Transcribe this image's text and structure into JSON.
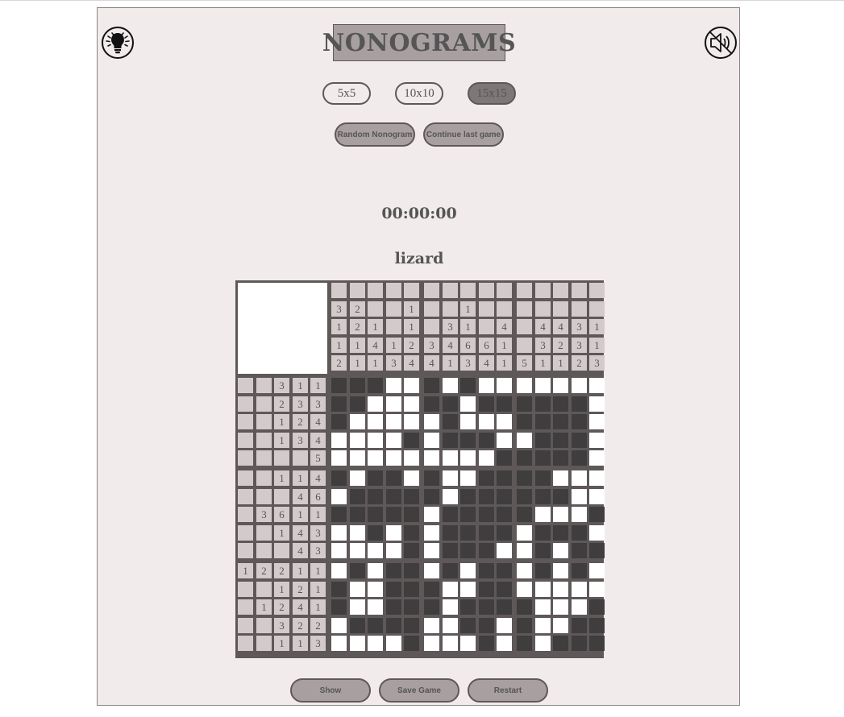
{
  "app": {
    "title": "NONOGRAMS",
    "hint_icon": "lightbulb-icon",
    "sound_icon": "speaker-muted-icon"
  },
  "sizes": [
    {
      "label": "5x5",
      "active": false
    },
    {
      "label": "10x10",
      "active": false
    },
    {
      "label": "15x15",
      "active": true
    }
  ],
  "actions": {
    "random": "Random Nonogram",
    "continue": "Continue last game"
  },
  "timer": "00:00:00",
  "puzzle_name": "lizard",
  "board": {
    "size": 15,
    "col_clues": [
      [
        "3",
        "1",
        "1",
        "2"
      ],
      [
        "2",
        "2",
        "1",
        "1"
      ],
      [
        "1",
        "4",
        "1"
      ],
      [
        "1",
        "3"
      ],
      [
        "1",
        "1",
        "2",
        "4"
      ],
      [
        "3",
        "4"
      ],
      [
        "3",
        "4",
        "1"
      ],
      [
        "1",
        "1",
        "6",
        "3"
      ],
      [
        "6",
        "4"
      ],
      [
        "4",
        "1",
        "1"
      ],
      [
        "5"
      ],
      [
        "4",
        "3",
        "1"
      ],
      [
        "4",
        "2",
        "1"
      ],
      [
        "3",
        "3",
        "2"
      ],
      [
        "1",
        "1",
        "3"
      ]
    ],
    "row_clues": [
      [
        "3",
        "1",
        "1"
      ],
      [
        "2",
        "3",
        "3"
      ],
      [
        "1",
        "2",
        "4"
      ],
      [
        "1",
        "3",
        "4"
      ],
      [
        "5"
      ],
      [
        "1",
        "1",
        "4"
      ],
      [
        "4",
        "6"
      ],
      [
        "3",
        "6",
        "1",
        "1"
      ],
      [
        "1",
        "4",
        "3"
      ],
      [
        "4",
        "3"
      ],
      [
        "1",
        "2",
        "2",
        "1",
        "1"
      ],
      [
        "1",
        "2",
        "1"
      ],
      [
        "1",
        "2",
        "4",
        "1"
      ],
      [
        "3",
        "2",
        "2"
      ],
      [
        "1",
        "1",
        "3"
      ]
    ],
    "grid": [
      "111001010000000",
      "110001101111110",
      "100000100011110",
      "000010111001110",
      "000000000111110",
      "101101001111000",
      "011111011111100",
      "111110111110001",
      "001010111101110",
      "000010111001011",
      "010110101101010",
      "100111001100000",
      "100111011110001",
      "011110011010011",
      "000010001010111"
    ],
    "colors": {
      "filled": "#3f3d3d",
      "empty": "#ffffff",
      "clue": "#d3cbcb",
      "frame": "#5e5858"
    }
  },
  "bottom": {
    "show": "Show",
    "save": "Save Game",
    "restart": "Restart"
  }
}
